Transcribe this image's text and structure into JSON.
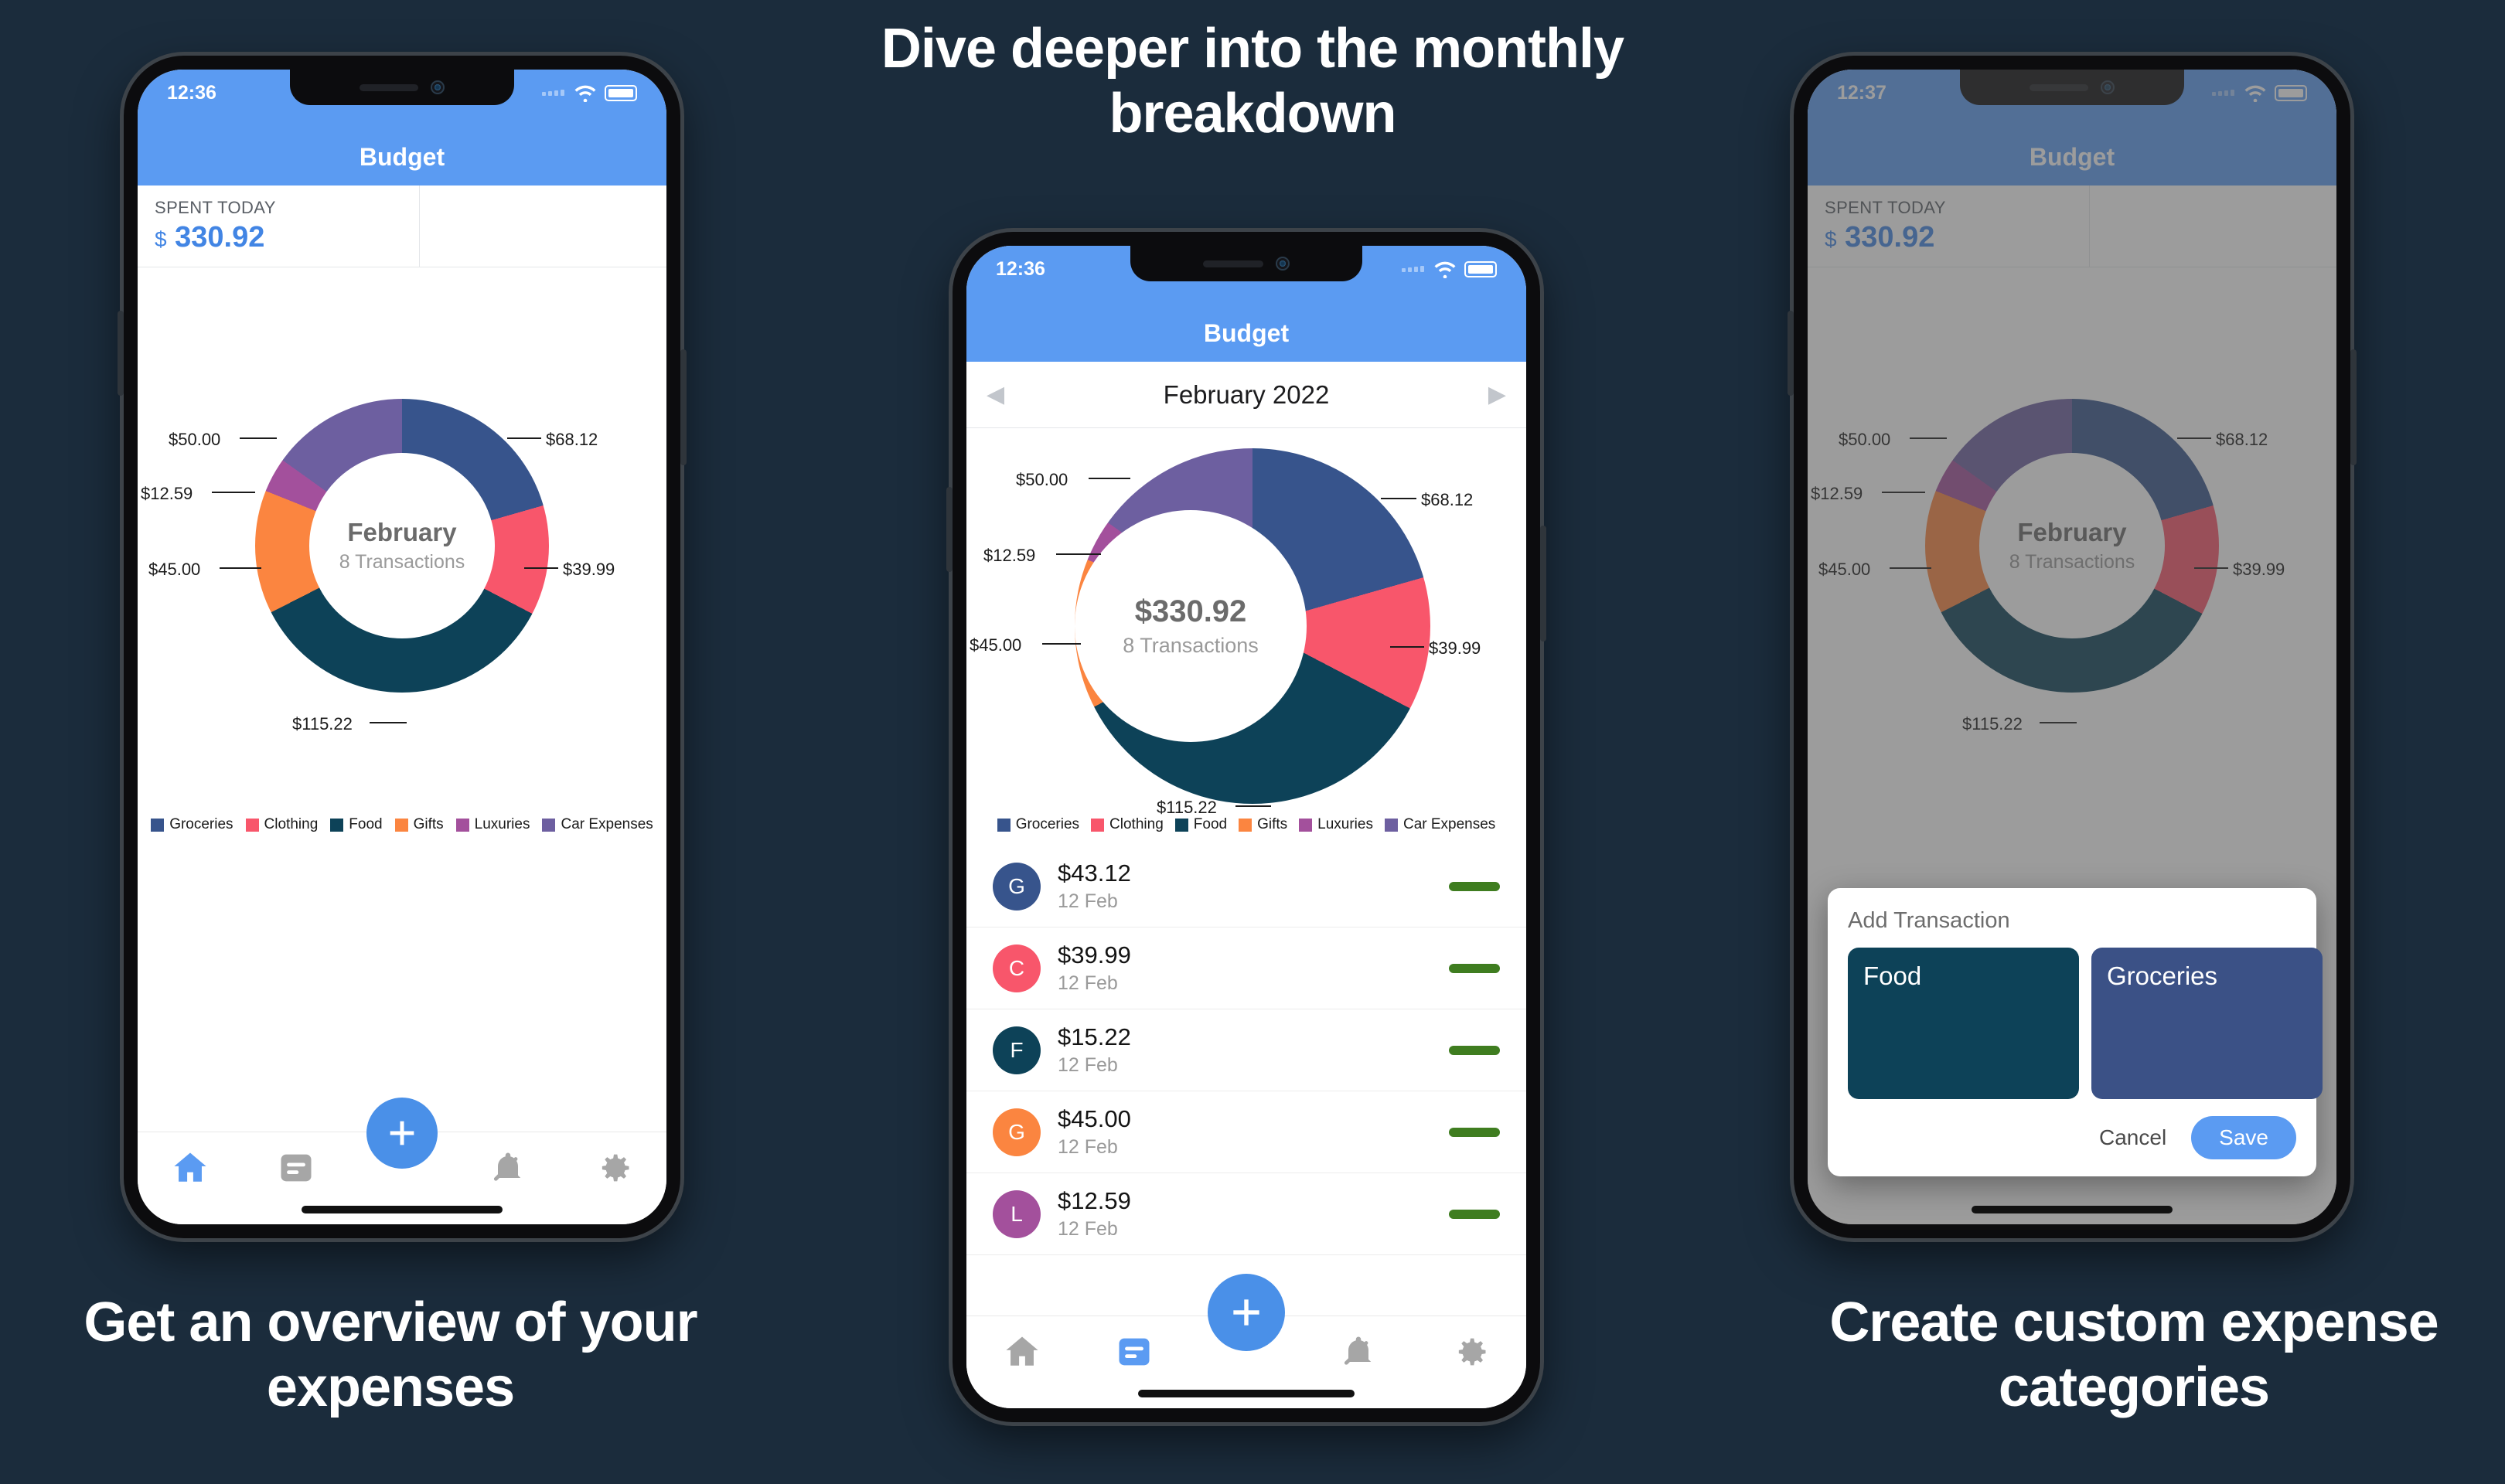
{
  "marketing": {
    "headline_top": "Dive deeper into the monthly breakdown",
    "caption_left": "Get an overview of your expenses",
    "caption_right": "Create custom expense categories"
  },
  "colors": {
    "background": "#1b2c3c",
    "appbar": "#5b9bf2",
    "accent": "#4a90e8",
    "amount": "#4285e4",
    "groceries": "#37548c",
    "clothing": "#f8566b",
    "food": "#0d4258",
    "gifts": "#fb8540",
    "luxuries": "#a3509c",
    "car_expenses": "#6d5fa0",
    "bar_green": "#3f7d20"
  },
  "legend": [
    {
      "label": "Groceries",
      "color": "#37548c"
    },
    {
      "label": "Clothing",
      "color": "#f8566b"
    },
    {
      "label": "Food",
      "color": "#0d4258"
    },
    {
      "label": "Gifts",
      "color": "#fb8540"
    },
    {
      "label": "Luxuries",
      "color": "#a3509c"
    },
    {
      "label": "Car Expenses",
      "color": "#6d5fa0"
    }
  ],
  "phone1": {
    "status": {
      "time": "12:36",
      "wifi": "wifi-icon",
      "battery": "battery-icon"
    },
    "app_title": "Budget",
    "summary": {
      "label": "SPENT TODAY",
      "currency": "$",
      "value": "330.92"
    },
    "donut_center": {
      "main": "February",
      "sub": "8 Transactions"
    },
    "nav": [
      {
        "name": "home",
        "active": true
      },
      {
        "name": "list",
        "active": false
      },
      {
        "name": "add",
        "active": true
      },
      {
        "name": "bell-off",
        "active": false
      },
      {
        "name": "gear",
        "active": false
      }
    ]
  },
  "phone2": {
    "status": {
      "time": "12:36"
    },
    "app_title": "Budget",
    "month_label": "February 2022",
    "prev_arrow": "◀",
    "next_arrow": "▶",
    "donut_center": {
      "main": "$330.92",
      "sub": "8 Transactions"
    },
    "transactions": [
      {
        "initial": "G",
        "color": "#37548c",
        "amount": "$43.12",
        "date": "12 Feb"
      },
      {
        "initial": "C",
        "color": "#f8566b",
        "amount": "$39.99",
        "date": "12 Feb"
      },
      {
        "initial": "F",
        "color": "#0d4258",
        "amount": "$15.22",
        "date": "12 Feb"
      },
      {
        "initial": "G",
        "color": "#fb8540",
        "amount": "$45.00",
        "date": "12 Feb"
      },
      {
        "initial": "L",
        "color": "#a3509c",
        "amount": "$12.59",
        "date": "12 Feb"
      }
    ],
    "nav": [
      {
        "name": "home",
        "active": false
      },
      {
        "name": "list",
        "active": true
      },
      {
        "name": "add",
        "active": true
      },
      {
        "name": "bell-off",
        "active": false
      },
      {
        "name": "gear",
        "active": false
      }
    ]
  },
  "phone3": {
    "status": {
      "time": "12:37"
    },
    "app_title": "Budget",
    "summary": {
      "label": "SPENT TODAY",
      "currency": "$",
      "value": "330.92"
    },
    "donut_center": {
      "main": "February",
      "sub": "8 Transactions"
    },
    "modal": {
      "title": "Add Transaction",
      "categories": [
        {
          "label": "Food",
          "color": "#0d4258"
        },
        {
          "label": "Groceries",
          "color": "#3b5186"
        }
      ],
      "cancel_label": "Cancel",
      "save_label": "Save"
    }
  },
  "chart_data": {
    "type": "pie",
    "title": "February 2022 spending breakdown",
    "total": 330.92,
    "total_label": "$330.92",
    "transaction_count": 8,
    "transaction_count_label": "8 Transactions",
    "categories": [
      "Groceries",
      "Clothing",
      "Food",
      "Gifts",
      "Luxuries",
      "Car Expenses"
    ],
    "values": [
      68.12,
      39.99,
      115.22,
      45.0,
      12.59,
      50.0
    ],
    "value_labels": [
      "$68.12",
      "$39.99",
      "$115.22",
      "$45.00",
      "$12.59",
      "$50.00"
    ],
    "colors": [
      "#37548c",
      "#f8566b",
      "#0d4258",
      "#fb8540",
      "#a3509c",
      "#6d5fa0"
    ],
    "legend_position": "bottom",
    "grid": false,
    "donut": true
  }
}
